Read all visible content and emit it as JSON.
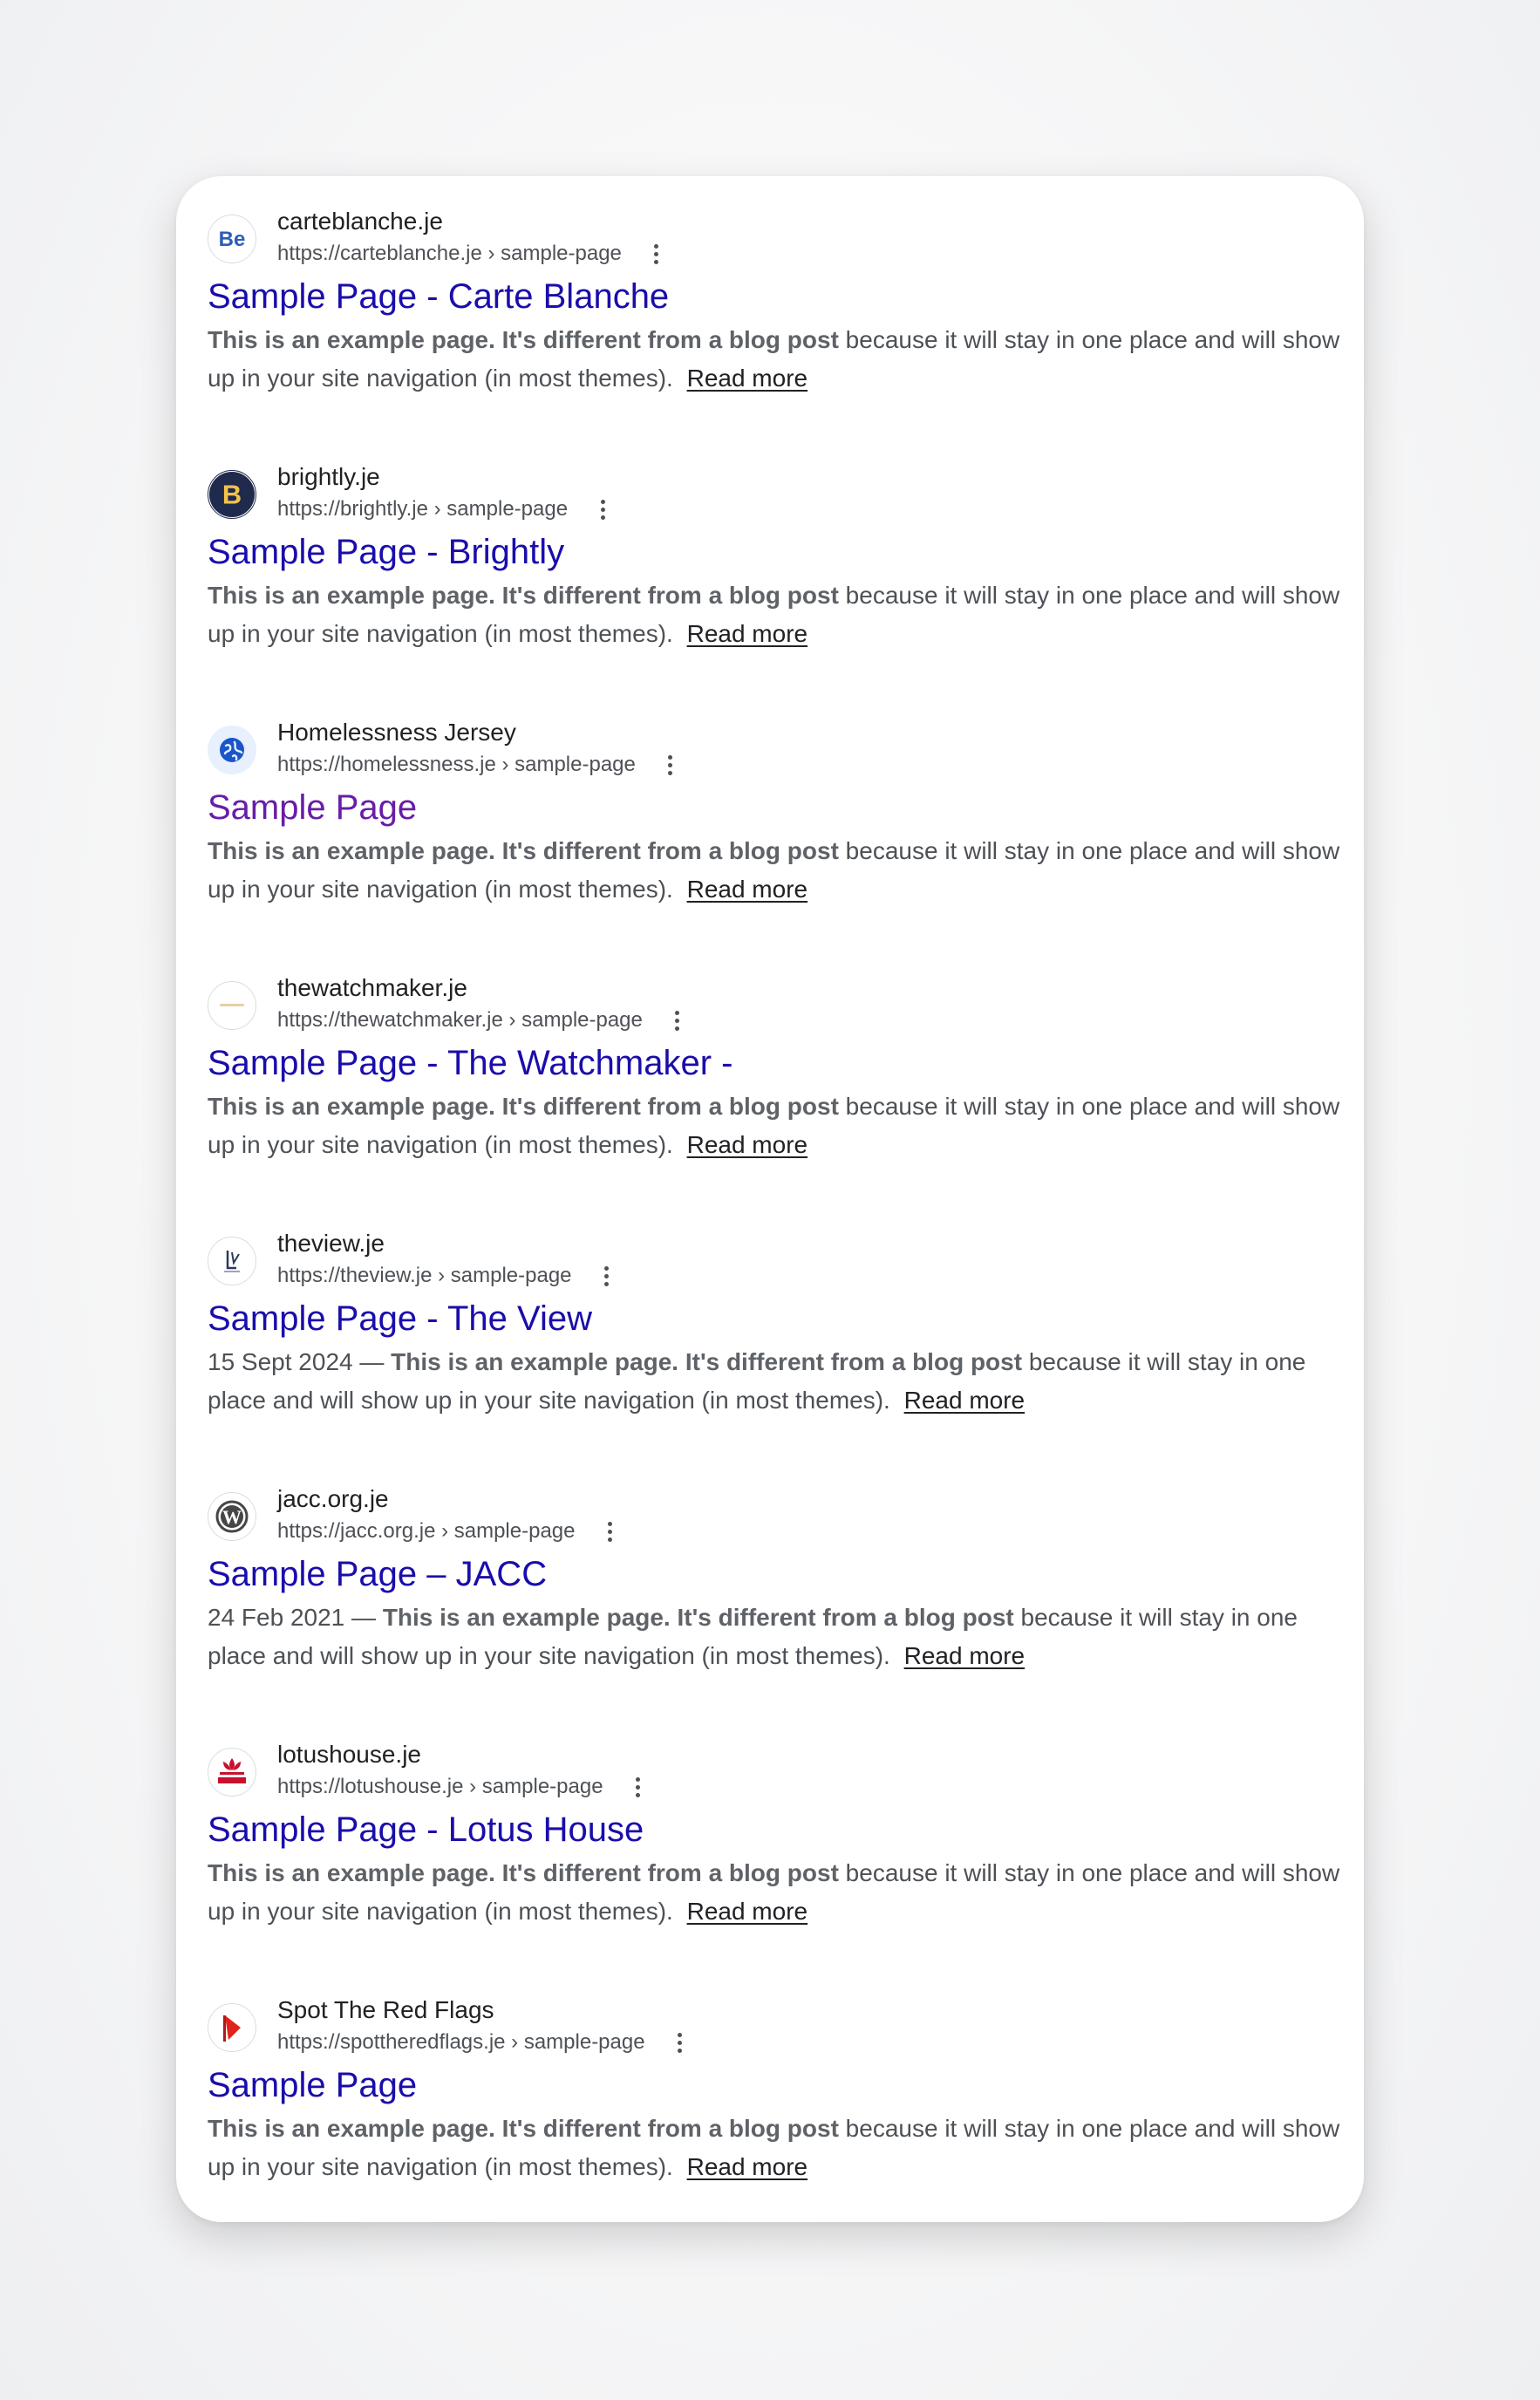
{
  "results": [
    {
      "site": "carteblanche.je",
      "url": "https://carteblanche.je › sample-page",
      "title": "Sample Page - Carte Blanche",
      "visited": false,
      "favicon": "behance-be-icon",
      "date": "",
      "snippet_bold": "This is an example page. It's different from a blog post",
      "snippet_rest": " because it will stay in one place and will show up in your site navigation (in most themes).",
      "read_more": "Read more"
    },
    {
      "site": "brightly.je",
      "url": "https://brightly.je › sample-page",
      "title": "Sample Page - Brightly",
      "visited": false,
      "favicon": "brightly-b-icon",
      "date": "",
      "snippet_bold": "This is an example page. It's different from a blog post",
      "snippet_rest": " because it will stay in one place and will show up in your site navigation (in most themes).",
      "read_more": "Read more"
    },
    {
      "site": "Homelessness Jersey",
      "url": "https://homelessness.je › sample-page",
      "title": "Sample Page",
      "visited": true,
      "favicon": "globe-icon",
      "date": "",
      "snippet_bold": "This is an example page. It's different from a blog post",
      "snippet_rest": " because it will stay in one place and will show up in your site navigation (in most themes).",
      "read_more": "Read more"
    },
    {
      "site": "thewatchmaker.je",
      "url": "https://thewatchmaker.je › sample-page",
      "title": "Sample Page - The Watchmaker -",
      "visited": false,
      "favicon": "watchmaker-logo-icon",
      "date": "",
      "snippet_bold": "This is an example page. It's different from a blog post",
      "snippet_rest": " because it will stay in one place and will show up in your site navigation (in most themes).",
      "read_more": "Read more"
    },
    {
      "site": "theview.je",
      "url": "https://theview.je › sample-page",
      "title": "Sample Page - The View",
      "visited": false,
      "favicon": "theview-logo-icon",
      "date": "15 Sept 2024 — ",
      "snippet_bold": "This is an example page. It's different from a blog post",
      "snippet_rest": " because it will stay in one place and will show up in your site navigation (in most themes).",
      "read_more": "Read more"
    },
    {
      "site": "jacc.org.je",
      "url": "https://jacc.org.je › sample-page",
      "title": "Sample Page – JACC",
      "visited": false,
      "favicon": "wordpress-icon",
      "date": "24 Feb 2021 — ",
      "snippet_bold": "This is an example page. It's different from a blog post",
      "snippet_rest": " because it will stay in one place and will show up in your site navigation (in most themes).",
      "read_more": "Read more"
    },
    {
      "site": "lotushouse.je",
      "url": "https://lotushouse.je › sample-page",
      "title": "Sample Page - Lotus House",
      "visited": false,
      "favicon": "lotus-house-logo-icon",
      "date": "",
      "snippet_bold": "This is an example page. It's different from a blog post",
      "snippet_rest": " because it will stay in one place and will show up in your site navigation (in most themes).",
      "read_more": "Read more"
    },
    {
      "site": "Spot The Red Flags",
      "url": "https://spottheredflags.je › sample-page",
      "title": "Sample Page",
      "visited": false,
      "favicon": "red-flag-icon",
      "date": "",
      "snippet_bold": "This is an example page. It's different from a blog post",
      "snippet_rest": " because it will stay in one place and will show up in your site navigation (in most themes).",
      "read_more": "Read more"
    }
  ],
  "colors": {
    "title_link": "#1a0dab",
    "title_visited": "#681da8",
    "snippet_text": "#4d5156"
  }
}
